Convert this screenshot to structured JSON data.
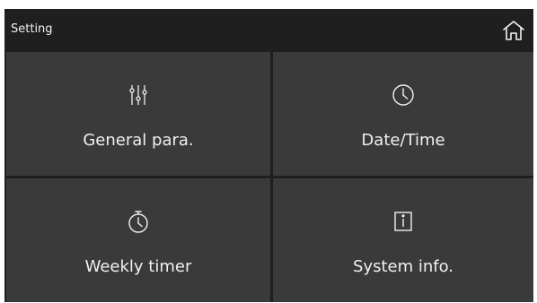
{
  "header": {
    "title": "Setting",
    "home_icon": "home-icon"
  },
  "tiles": [
    {
      "label": "General para.",
      "icon": "sliders-icon"
    },
    {
      "label": "Date/Time",
      "icon": "clock-icon"
    },
    {
      "label": "Weekly timer",
      "icon": "stopwatch-icon"
    },
    {
      "label": "System info.",
      "icon": "info-icon"
    }
  ],
  "colors": {
    "background": "#1f1f1f",
    "tile": "#3a3a3a",
    "text": "#f0f0f0"
  }
}
